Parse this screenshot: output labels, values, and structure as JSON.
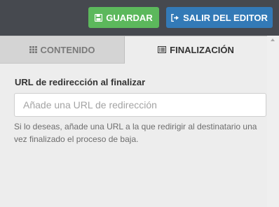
{
  "toolbar": {
    "save_label": "GUARDAR",
    "exit_label": "SALIR DEL EDITOR",
    "save_color": "#5cb85c",
    "exit_color": "#337ab7",
    "save_icon": "floppy-disk-icon",
    "exit_icon": "sign-out-icon"
  },
  "tabs": [
    {
      "label": "CONTENIDO",
      "icon": "grid-icon",
      "active": false
    },
    {
      "label": "FINALIZACIÓN",
      "icon": "list-alt-icon",
      "active": true
    }
  ],
  "form": {
    "redirect_label": "URL de redirección al finalizar",
    "redirect_value": "",
    "redirect_placeholder": "Añade una URL de redirección",
    "help_text": "Si lo deseas, añade una URL a la que redirigir al destinatario una vez finalizado el proceso de baja."
  }
}
